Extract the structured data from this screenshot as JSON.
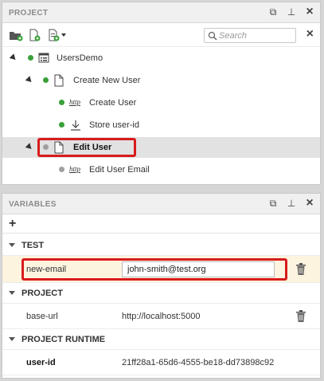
{
  "project_panel": {
    "title": "PROJECT",
    "search_placeholder": "Search",
    "tree": [
      {
        "label": "UsersDemo",
        "status": "green",
        "icon": "project-icon"
      },
      {
        "label": "Create New User",
        "status": "green",
        "icon": "document-icon"
      },
      {
        "label": "Create User",
        "status": "green",
        "icon": "http-icon",
        "icon_text": "http"
      },
      {
        "label": "Store user-id",
        "status": "green",
        "icon": "download-icon"
      },
      {
        "label": "Edit User",
        "status": "gray",
        "icon": "document-icon",
        "selected": true
      },
      {
        "label": "Edit User Email",
        "status": "gray",
        "icon": "http-icon",
        "icon_text": "http"
      }
    ]
  },
  "variables_panel": {
    "title": "VARIABLES",
    "sections": [
      {
        "name": "TEST",
        "vars": [
          {
            "name": "new-email",
            "value": "john-smith@test.org"
          }
        ]
      },
      {
        "name": "PROJECT",
        "vars": [
          {
            "name": "base-url",
            "value": "http://localhost:5000"
          }
        ]
      },
      {
        "name": "PROJECT RUNTIME",
        "vars": [
          {
            "name": "user-id",
            "value": "21ff28a1-65d6-4555-be18-dd73898c92"
          }
        ]
      }
    ]
  },
  "colors": {
    "status_green": "#3aa03a",
    "status_gray": "#a0a0a0",
    "highlight": "#d81b1b",
    "active_row": "#fdf4e0"
  }
}
